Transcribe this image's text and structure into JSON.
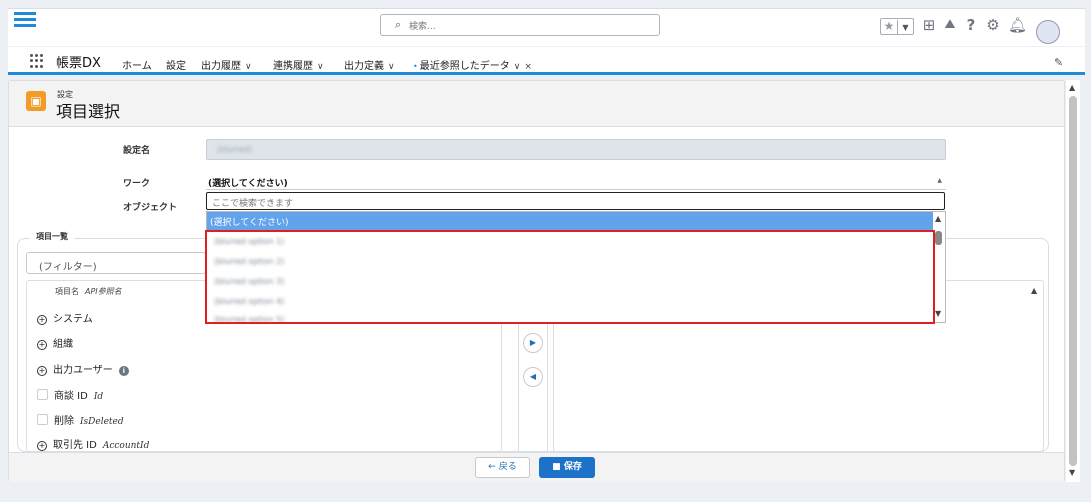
{
  "search": {
    "placeholder": "検索..."
  },
  "app": {
    "name": "帳票DX"
  },
  "nav": {
    "items": [
      "ホーム",
      "設定",
      "出力履歴",
      "連携履歴",
      "出力定義",
      "最近参照したデータ"
    ],
    "close": "×"
  },
  "header": {
    "subtitle": "設定",
    "title": "項目選択"
  },
  "form": {
    "setting_name_label": "設定名",
    "setting_name_value": "(blurred)",
    "work_label": "ワーク",
    "work_value": "(選択してください)",
    "object_label": "オブジェクト"
  },
  "dropdown": {
    "search_placeholder": "ここで検索できます",
    "selected": "(選択してください)",
    "options": [
      "(blurred option 1)",
      "(blurred option 2)",
      "(blurred option 3)",
      "(blurred option 4)",
      "(blurred option 5)"
    ]
  },
  "items": {
    "legend": "項目一覧",
    "filter_placeholder": "(フィルター)",
    "col_name": "項目名",
    "col_api": "API参照名",
    "rows": [
      {
        "type": "group",
        "label": "システム",
        "api": ""
      },
      {
        "type": "group",
        "label": "組織",
        "api": ""
      },
      {
        "type": "group-info",
        "label": "出力ユーザー",
        "api": ""
      },
      {
        "type": "field",
        "label": "商談 ID",
        "api": "Id"
      },
      {
        "type": "field",
        "label": "削除",
        "api": "IsDeleted"
      },
      {
        "type": "group",
        "label": "取引先 ID",
        "api": "AccountId"
      }
    ]
  },
  "footer": {
    "back": "戻る",
    "save": "保存"
  },
  "colors": {
    "accent": "#1f8ad7",
    "highlight": "#62a3ec",
    "annotation": "#e02020",
    "header_icon": "#f29c27",
    "save": "#1b72c7"
  }
}
